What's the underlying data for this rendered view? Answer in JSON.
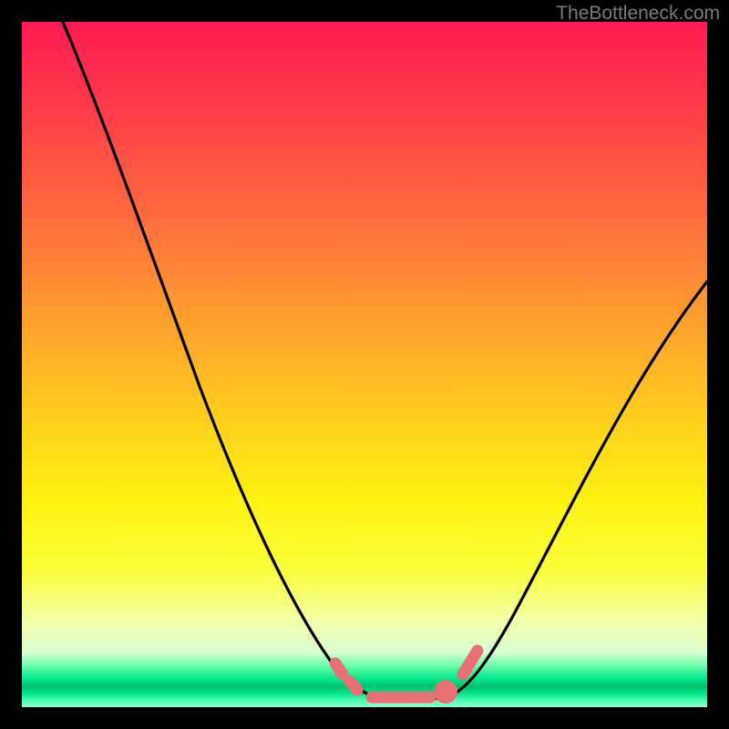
{
  "watermark": {
    "text": "TheBottleneck.com"
  },
  "chart_data": {
    "type": "line",
    "title": "",
    "xlabel": "",
    "ylabel": "",
    "xlim": [
      0,
      100
    ],
    "ylim": [
      0,
      100
    ],
    "grid": false,
    "legend": false,
    "series": [
      {
        "name": "bottleneck-curve",
        "x": [
          6,
          10,
          15,
          20,
          25,
          30,
          35,
          40,
          45,
          50,
          53,
          56,
          60,
          64,
          70,
          76,
          82,
          88,
          94,
          100
        ],
        "values": [
          100,
          88,
          75,
          63,
          52,
          41,
          31,
          22,
          14,
          7,
          3,
          1,
          1,
          3,
          10,
          20,
          32,
          44,
          55,
          62
        ],
        "note": "Values are bottleneck percentage estimated from unmarked axes; dip reaches ~0-1% around x≈56-60."
      }
    ],
    "markers": {
      "note": "Small pink dot/segment markers near the trough of the curve.",
      "points_x": [
        46,
        48,
        51,
        58,
        62,
        64,
        66
      ],
      "points_y": [
        5,
        3,
        2,
        2,
        4,
        6,
        8
      ]
    },
    "gradient_stops": [
      {
        "pct": 0,
        "color": "#ff1a52"
      },
      {
        "pct": 28,
        "color": "#ff6a3d"
      },
      {
        "pct": 56,
        "color": "#ffc81f"
      },
      {
        "pct": 80,
        "color": "#faff3a"
      },
      {
        "pct": 94,
        "color": "#66ffac"
      },
      {
        "pct": 100,
        "color": "#8cffce"
      }
    ]
  }
}
